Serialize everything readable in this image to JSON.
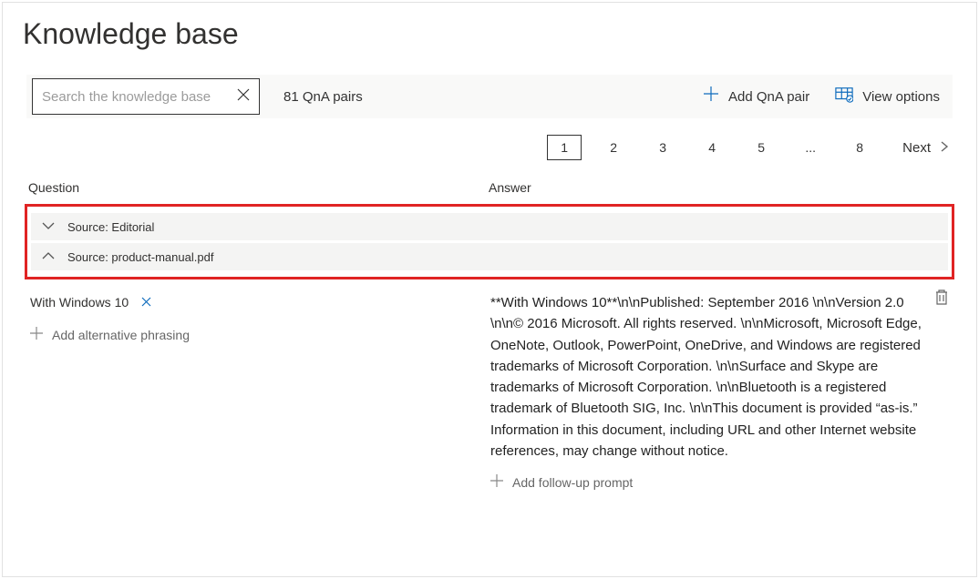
{
  "title": "Knowledge base",
  "search": {
    "placeholder": "Search the knowledge base"
  },
  "count": "81 QnA pairs",
  "toolbar": {
    "add": "Add QnA pair",
    "view": "View options"
  },
  "pagination": {
    "pages": [
      "1",
      "2",
      "3",
      "4",
      "5",
      "...",
      "8"
    ],
    "next": "Next"
  },
  "columns": {
    "question": "Question",
    "answer": "Answer"
  },
  "sources": {
    "s1": "Source: Editorial",
    "s2": "Source: product-manual.pdf"
  },
  "qa": {
    "question": "With Windows 10",
    "addAlt": "Add alternative phrasing",
    "answer": "**With Windows 10**\\n\\nPublished: September 2016 \\n\\nVersion 2.0 \\n\\n© 2016 Microsoft. All rights reserved. \\n\\nMicrosoft, Microsoft Edge, OneNote, Outlook, PowerPoint, OneDrive, and Windows are registered trademarks of Microsoft Corporation. \\n\\nSurface and Skype are trademarks of Microsoft Corporation. \\n\\nBluetooth is a registered trademark of Bluetooth SIG, Inc. \\n\\nThis document is provided “as-is.” Information in this document, including URL and other Internet website references, may change without notice.",
    "follow": "Add follow-up prompt"
  }
}
